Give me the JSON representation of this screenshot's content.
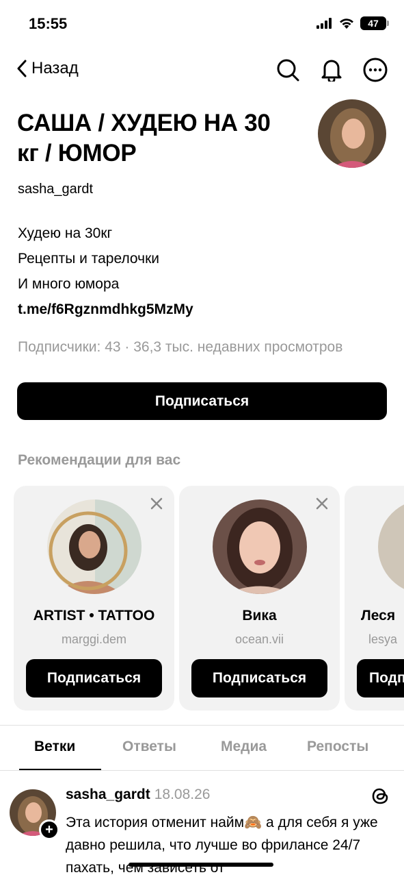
{
  "status_bar": {
    "time": "15:55",
    "battery": "47"
  },
  "nav": {
    "back_label": "Назад"
  },
  "profile": {
    "name": "САША / ХУДЕЮ НА 30 кг / ЮМОР",
    "username": "sasha_gardt",
    "bio_lines": [
      "Худею на 30кг",
      "Рецепты и тарелочки",
      "И много юмора"
    ],
    "bio_link": "t.me/f6Rgznmdhkg5MzMy",
    "stats": "Подписчики: 43 · 36,3 тыс. недавних просмотров",
    "follow_label": "Подписаться"
  },
  "recommendations": {
    "title": "Рекомендации для вас",
    "items": [
      {
        "name": "ARTIST • TATTOO",
        "handle": "marggi.dem",
        "button": "Подписаться"
      },
      {
        "name": "Вика",
        "handle": "ocean.vii",
        "button": "Подписаться"
      },
      {
        "name": "Леся",
        "handle": "lesya",
        "button": "Подписаться"
      }
    ]
  },
  "tabs": [
    "Ветки",
    "Ответы",
    "Медиа",
    "Репосты"
  ],
  "post": {
    "author": "sasha_gardt",
    "date": "18.08.26",
    "text": "Эта история отменит найм🙈 а для себя я уже давно решила, что лучше во фрилансе 24/7 пахать, чем зависеть от"
  },
  "colors": {
    "primary": "#000000",
    "muted": "#999999",
    "card_bg": "#f2f2f2"
  }
}
